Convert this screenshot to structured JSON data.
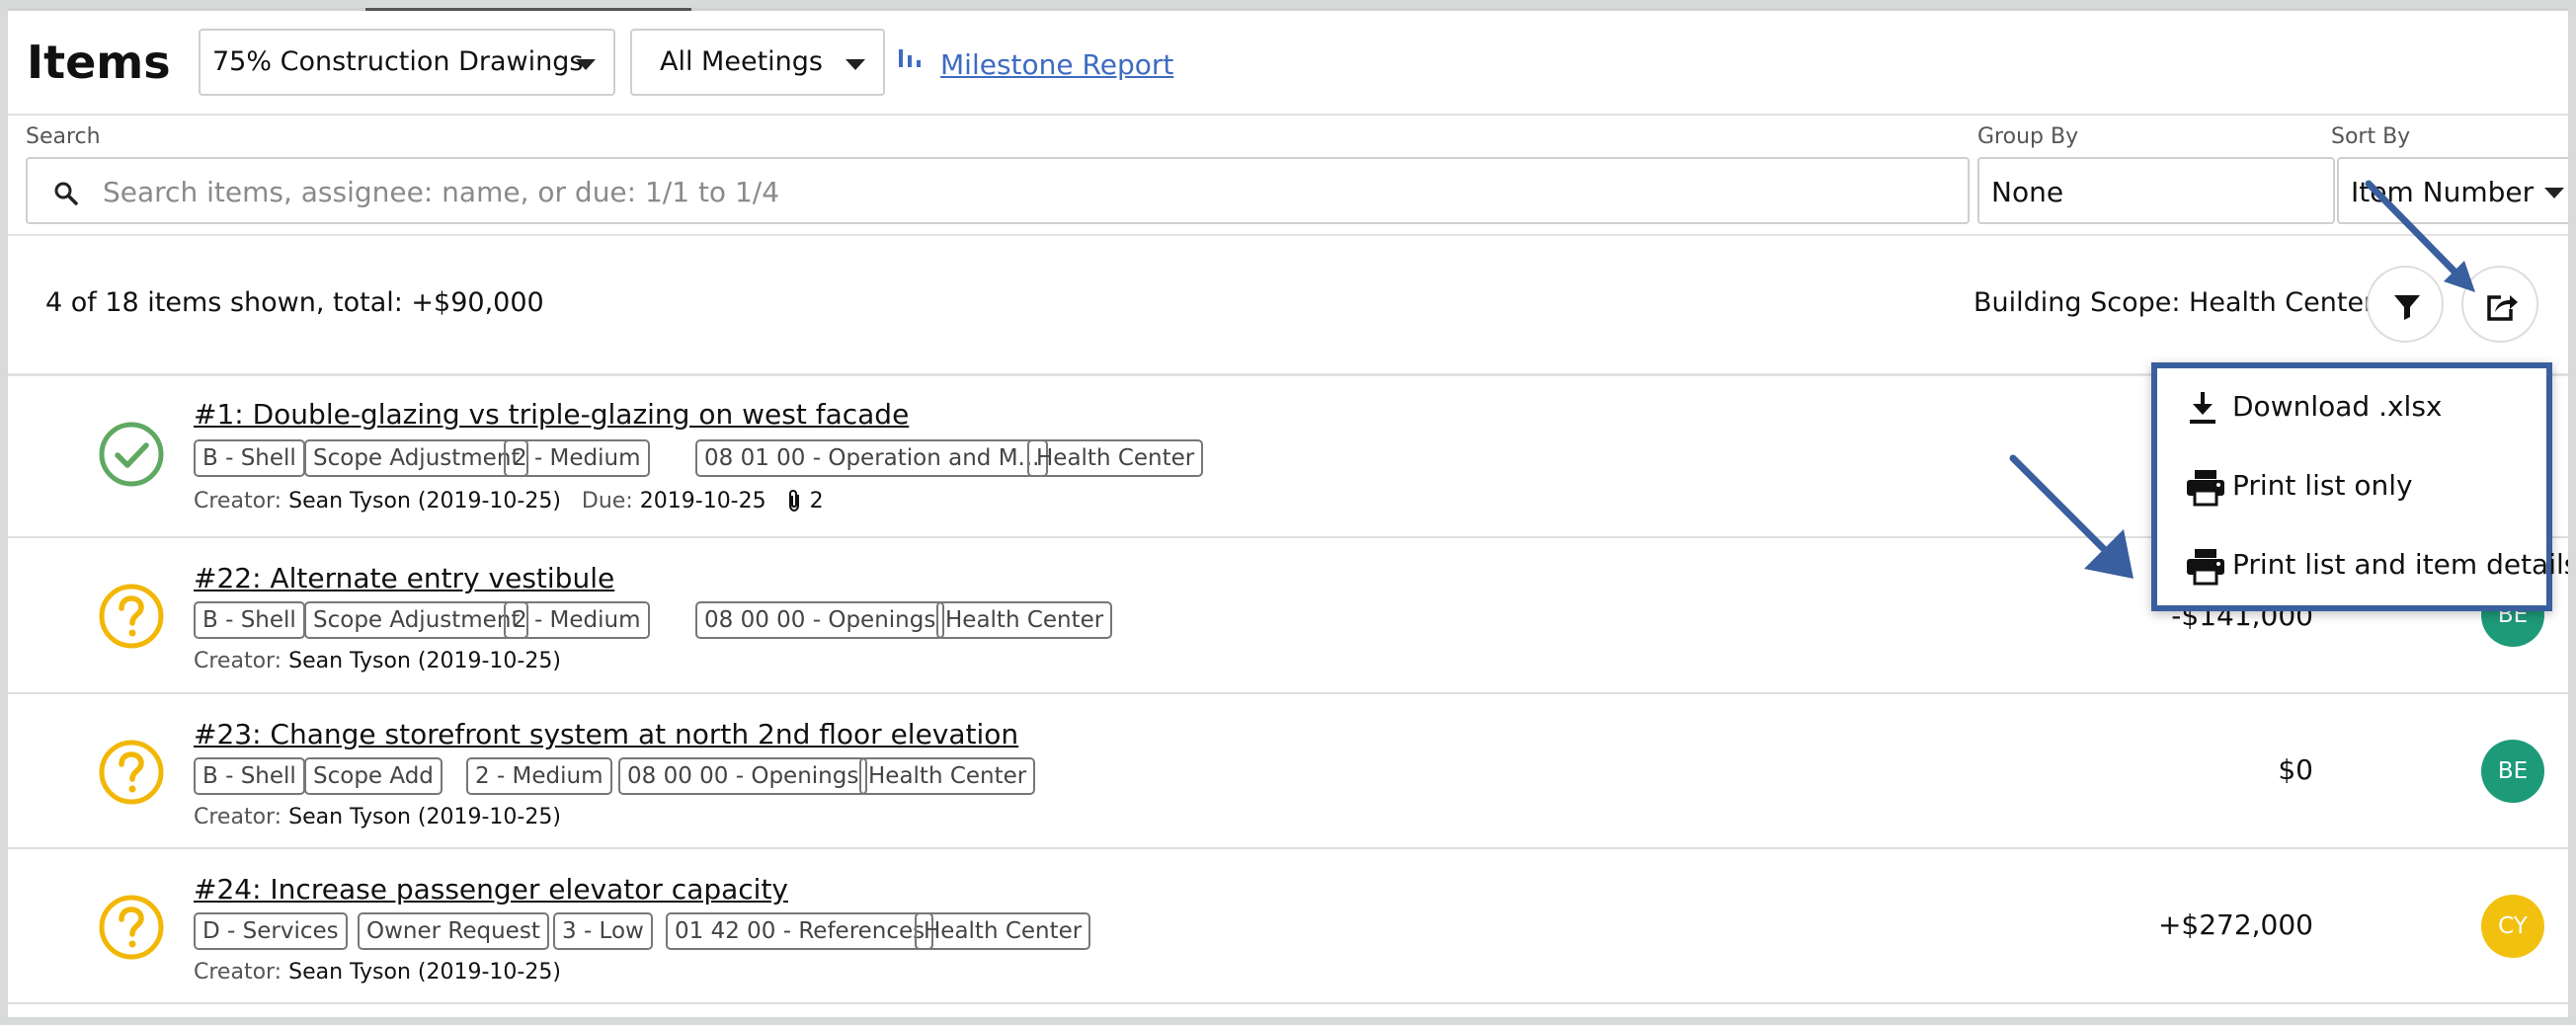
{
  "header": {
    "title": "Items",
    "milestone_select": "75% Construction Drawings",
    "meeting_select": "All Meetings",
    "milestone_report_link": "Milestone Report"
  },
  "search": {
    "label": "Search",
    "placeholder": "Search items, assignee: name, or due: 1/1 to 1/4",
    "group_by_label": "Group By",
    "group_by_value": "None",
    "sort_by_label": "Sort By",
    "sort_by_value": "Item Number"
  },
  "summary": {
    "count_text": "4 of 18 items shown, total: +$90,000",
    "scope_text": "Building Scope: Health Center"
  },
  "export_menu": {
    "download": "Download .xlsx",
    "print_list": "Print list only",
    "print_details": "Print list and item details"
  },
  "colors": {
    "accent_link": "#3e6bc2",
    "status_accepted": "#5fa862",
    "status_pending": "#f2b705",
    "annotation": "#3a5f9e",
    "avatar_be": "#1d9a78",
    "avatar_cy": "#f2c10f"
  },
  "items": [
    {
      "status": "check-circle-icon",
      "title": "#1: Double-glazing vs triple-glazing on west facade",
      "tags": [
        "B - Shell",
        "Scope Adjustment",
        "2 - Medium",
        "08 01 00 - Operation and M...",
        "Health Center"
      ],
      "creator_label": "Creator:",
      "creator": "Sean Tyson (2019-10-25)",
      "due_label": "Due:",
      "due": "2019-10-25",
      "attachments": "2",
      "cost": "",
      "avatar": ""
    },
    {
      "status": "question-circle-icon",
      "title": "#22: Alternate entry vestibule",
      "tags": [
        "B - Shell",
        "Scope Adjustment",
        "2 - Medium",
        "08 00 00 - Openings",
        "Health Center"
      ],
      "creator_label": "Creator:",
      "creator": "Sean Tyson (2019-10-25)",
      "cost": "-$141,000",
      "avatar": "BE"
    },
    {
      "status": "question-circle-icon",
      "title": "#23: Change storefront system at north 2nd floor elevation",
      "tags": [
        "B - Shell",
        "Scope Add",
        "2 - Medium",
        "08 00 00 - Openings",
        "Health Center"
      ],
      "creator_label": "Creator:",
      "creator": "Sean Tyson (2019-10-25)",
      "cost": "$0",
      "avatar": "BE"
    },
    {
      "status": "question-circle-icon",
      "title": "#24: Increase passenger elevator capacity",
      "tags": [
        "D - Services",
        "Owner Request",
        "3 - Low",
        "01 42 00 - References",
        "Health Center"
      ],
      "creator_label": "Creator:",
      "creator": "Sean Tyson (2019-10-25)",
      "cost": "+$272,000",
      "avatar": "CY"
    }
  ]
}
